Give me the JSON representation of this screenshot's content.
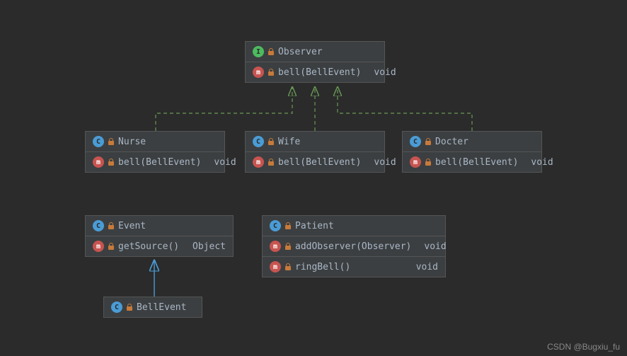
{
  "classes": {
    "observer": {
      "name": "Observer",
      "type": "interface",
      "methods": [
        {
          "sig": "bell(BellEvent)",
          "ret": "void"
        }
      ]
    },
    "nurse": {
      "name": "Nurse",
      "type": "class",
      "methods": [
        {
          "sig": "bell(BellEvent)",
          "ret": "void"
        }
      ]
    },
    "wife": {
      "name": "Wife",
      "type": "class",
      "methods": [
        {
          "sig": "bell(BellEvent)",
          "ret": "void"
        }
      ]
    },
    "docter": {
      "name": "Docter",
      "type": "class",
      "methods": [
        {
          "sig": "bell(BellEvent)",
          "ret": "void"
        }
      ]
    },
    "event": {
      "name": "Event",
      "type": "abstract-class",
      "methods": [
        {
          "sig": "getSource()",
          "ret": "Object"
        }
      ]
    },
    "patient": {
      "name": "Patient",
      "type": "class",
      "methods": [
        {
          "sig": "addObserver(Observer)",
          "ret": "void"
        },
        {
          "sig": "ringBell()",
          "ret": "void"
        }
      ]
    },
    "bellevent": {
      "name": "BellEvent",
      "type": "class",
      "methods": []
    }
  },
  "relationships": [
    {
      "from": "nurse",
      "to": "observer",
      "type": "realization"
    },
    {
      "from": "wife",
      "to": "observer",
      "type": "realization"
    },
    {
      "from": "docter",
      "to": "observer",
      "type": "realization"
    },
    {
      "from": "bellevent",
      "to": "event",
      "type": "generalization"
    }
  ],
  "watermark": "CSDN @Bugxiu_fu",
  "colors": {
    "bg": "#2b2b2b",
    "box": "#3c3f41",
    "border": "#555",
    "text": "#a9b7c6",
    "interface": "#4dbb5f",
    "class": "#4a9cd6",
    "method": "#c75450",
    "realization": "#6a9955",
    "generalization": "#4a9cd6"
  }
}
